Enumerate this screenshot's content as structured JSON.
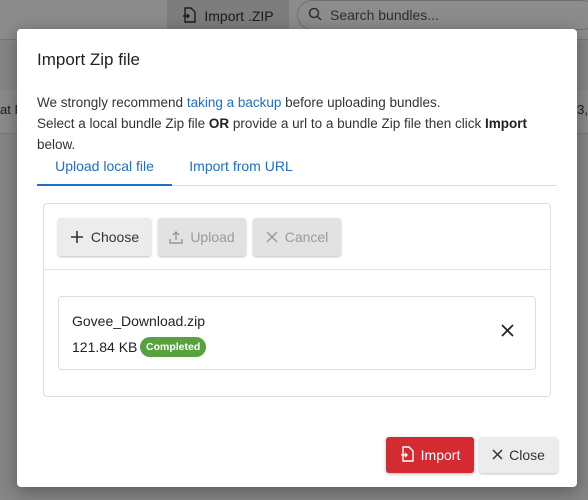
{
  "background": {
    "import_zip_label": "Import .ZIP",
    "search_placeholder": "Search bundles...",
    "row_left_text": "at R",
    "row_right_text": "3,"
  },
  "dialog": {
    "title": "Import Zip file",
    "intro": {
      "line1_before": "We strongly recommend ",
      "line1_link": "taking a backup",
      "line1_after": " before uploading bundles.",
      "line2_before": "Select a local bundle Zip file ",
      "line2_or": "OR",
      "line2_middle": " provide a url to a bundle Zip file then click ",
      "line2_import": "Import",
      "line2_after": " below."
    },
    "tabs": [
      {
        "label": "Upload local file",
        "active": true
      },
      {
        "label": "Import from URL",
        "active": false
      }
    ],
    "uploader": {
      "choose_label": "Choose",
      "upload_label": "Upload",
      "cancel_label": "Cancel",
      "file": {
        "name": "Govee_Download.zip",
        "size": "121.84 KB",
        "status": "Completed"
      }
    },
    "footer": {
      "import_label": "Import",
      "close_label": "Close"
    }
  },
  "colors": {
    "link": "#1f6fc5",
    "primary_danger": "#d42a32",
    "success_badge": "#58a13f"
  }
}
